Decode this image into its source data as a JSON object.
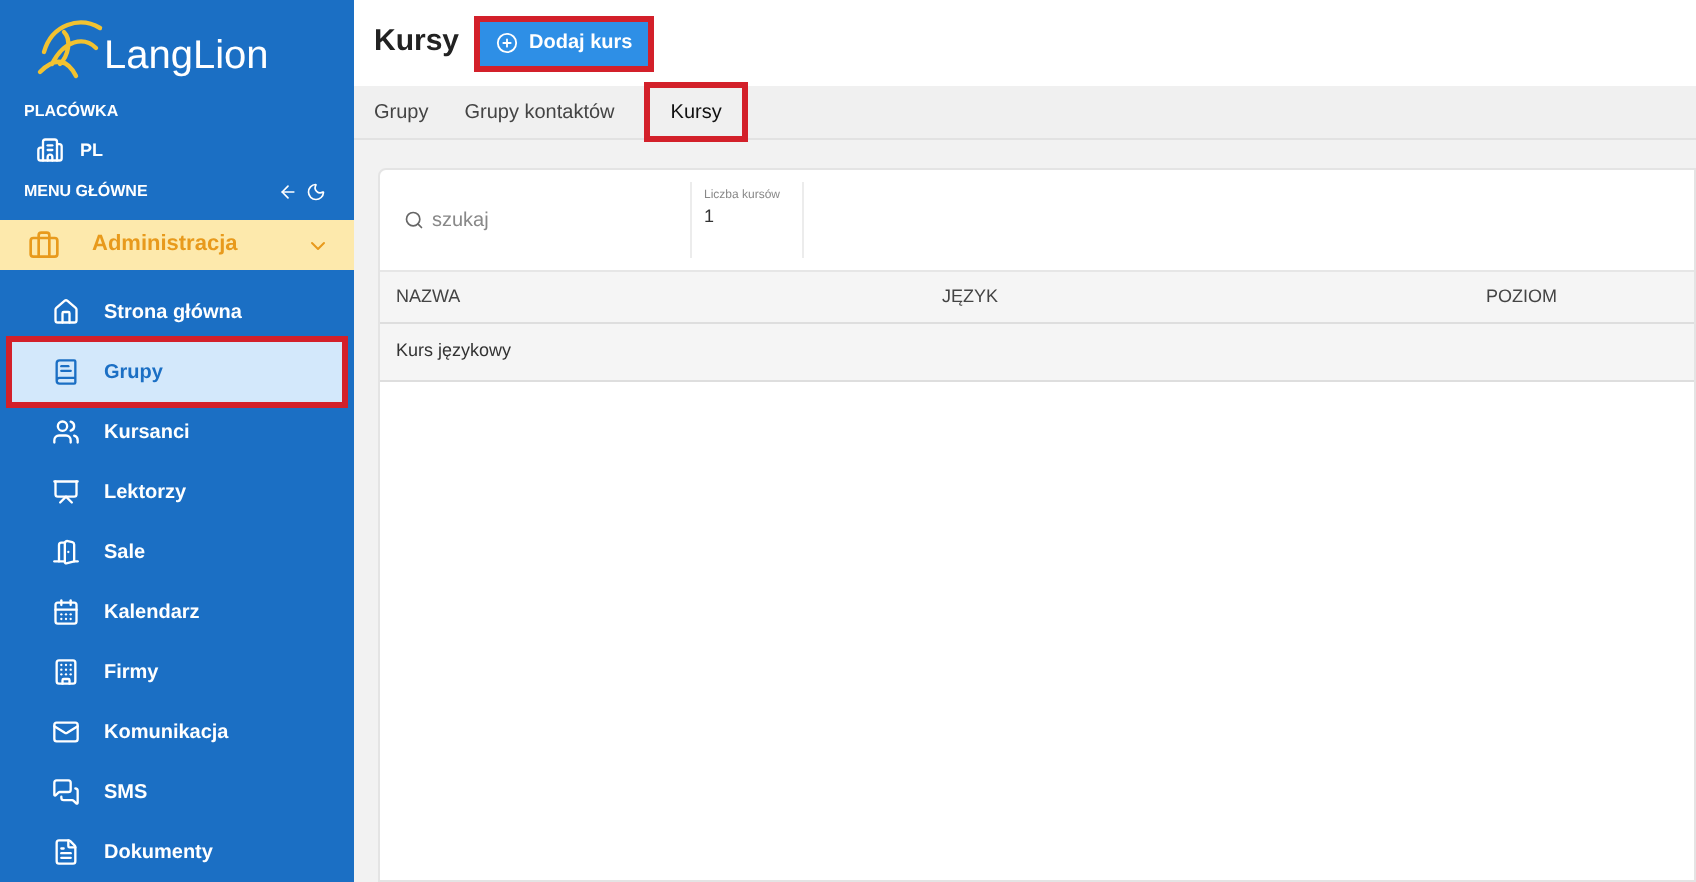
{
  "logo": {
    "text": "LangLion"
  },
  "sidebar": {
    "branch_label": "PLACÓWKA",
    "branch": "PL",
    "menu_label": "MENU GŁÓWNE",
    "section": {
      "label": "Administracja",
      "expanded": true,
      "selected": true
    },
    "items": [
      {
        "label": "Strona główna",
        "selected": false,
        "highlighted": false
      },
      {
        "label": "Grupy",
        "selected": true,
        "highlighted": true
      },
      {
        "label": "Kursanci",
        "selected": false,
        "highlighted": false
      },
      {
        "label": "Lektorzy",
        "selected": false,
        "highlighted": false
      },
      {
        "label": "Sale",
        "selected": false,
        "highlighted": false
      },
      {
        "label": "Kalendarz",
        "selected": false,
        "highlighted": false
      },
      {
        "label": "Firmy",
        "selected": false,
        "highlighted": false
      },
      {
        "label": "Komunikacja",
        "selected": false,
        "highlighted": false
      },
      {
        "label": "SMS",
        "selected": false,
        "highlighted": false
      },
      {
        "label": "Dokumenty",
        "selected": false,
        "highlighted": false
      }
    ]
  },
  "header": {
    "title": "Kursy",
    "add_button": {
      "label": "Dodaj kurs",
      "highlighted": true
    }
  },
  "tabs": [
    {
      "label": "Grupy",
      "selected": false,
      "highlighted": false
    },
    {
      "label": "Grupy kontaktów",
      "selected": false,
      "highlighted": false
    },
    {
      "label": "Kursy",
      "selected": true,
      "highlighted": true
    }
  ],
  "search": {
    "placeholder": "szukaj"
  },
  "stat": {
    "label": "Liczba kursów",
    "value": "1"
  },
  "table": {
    "columns": [
      "NAZWA",
      "JĘZYK",
      "POZIOM"
    ],
    "rows": [
      [
        "Kurs językowy",
        "",
        ""
      ]
    ]
  }
}
